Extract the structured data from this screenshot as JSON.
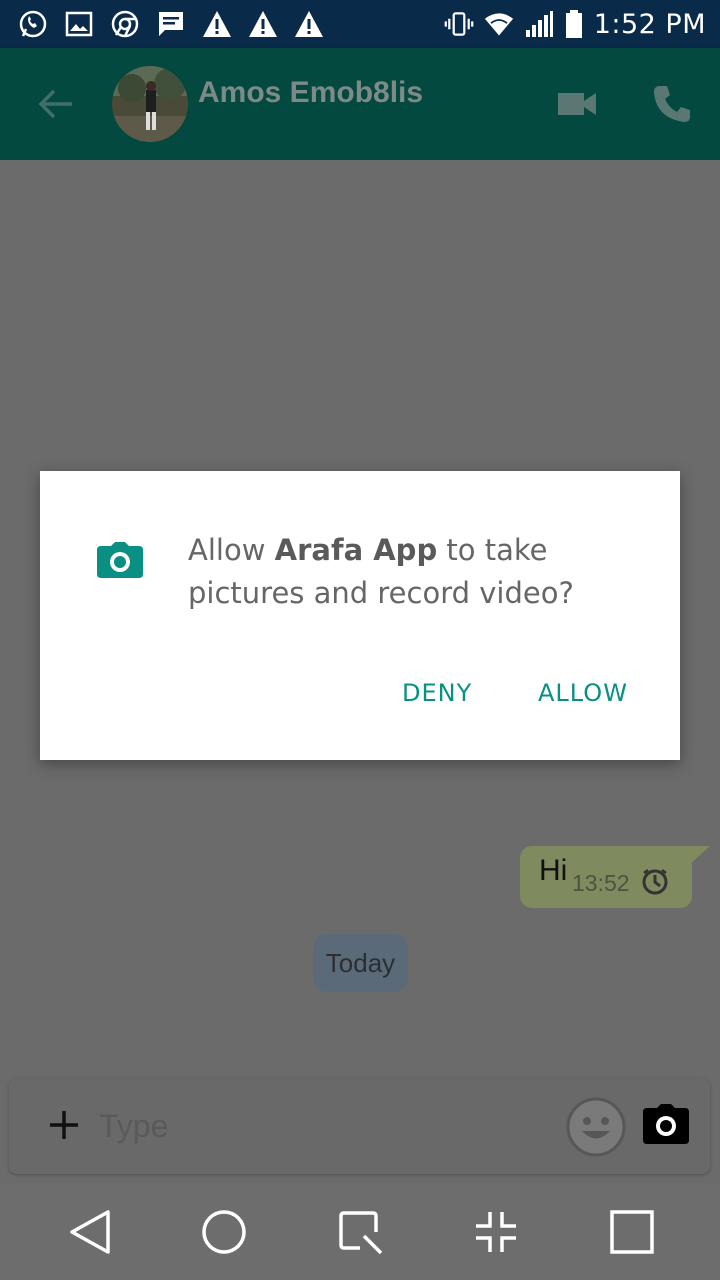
{
  "status_bar": {
    "left_icons": [
      "whatsapp-icon",
      "image-icon",
      "chrome-icon",
      "message-icon",
      "warning-icon",
      "warning-icon",
      "warning-icon"
    ],
    "right_icons": [
      "vibrate-icon",
      "wifi-icon",
      "signal-icon",
      "battery-icon"
    ],
    "time": "1:52 PM"
  },
  "toolbar": {
    "contact_name": "Amos Emob8lis",
    "icons": [
      "back-arrow-icon",
      "video-call-icon",
      "phone-icon"
    ]
  },
  "chat": {
    "date_chip": "Today",
    "messages": [
      {
        "text": "Hi",
        "time": "13:52",
        "status_icon": "pending-clock-icon"
      }
    ]
  },
  "input": {
    "placeholder": "Type",
    "icons": [
      "plus-icon",
      "emoji-icon",
      "camera-icon"
    ]
  },
  "nav_bar": {
    "icons": [
      "back-triangle-icon",
      "home-circle-icon",
      "capture-icon",
      "minimize-icon",
      "recents-square-icon"
    ]
  },
  "dialog": {
    "icon": "camera-icon",
    "message_prefix": "Allow ",
    "app_name": "Arafa App",
    "message_suffix": " to take pictures and record video?",
    "deny_label": "DENY",
    "allow_label": "ALLOW"
  },
  "colors": {
    "status_bar": "#0a2a4a",
    "toolbar": "#04493f",
    "scrim_background": "#6b6b6b",
    "accent": "#0a8f83",
    "outgoing_bubble": "#7f8b5e"
  }
}
